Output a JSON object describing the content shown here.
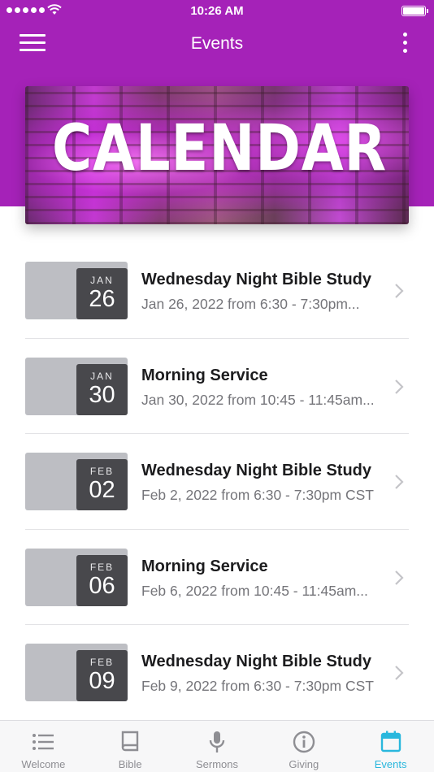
{
  "status_bar": {
    "time": "10:26 AM"
  },
  "nav": {
    "title": "Events"
  },
  "banner": {
    "text": "CALENDAR"
  },
  "events": [
    {
      "month": "JAN",
      "day": "26",
      "title": "Wednesday Night Bible Study",
      "time": "Jan 26, 2022 from 6:30 - 7:30pm..."
    },
    {
      "month": "JAN",
      "day": "30",
      "title": "Morning Service",
      "time": "Jan 30, 2022 from 10:45 - 11:45am..."
    },
    {
      "month": "FEB",
      "day": "02",
      "title": "Wednesday Night Bible Study",
      "time": "Feb 2, 2022 from 6:30 - 7:30pm CST"
    },
    {
      "month": "FEB",
      "day": "06",
      "title": "Morning Service",
      "time": "Feb 6, 2022 from 10:45 - 11:45am..."
    },
    {
      "month": "FEB",
      "day": "09",
      "title": "Wednesday Night Bible Study",
      "time": "Feb 9, 2022 from 6:30 - 7:30pm CST"
    }
  ],
  "tabs": [
    {
      "label": "Welcome",
      "icon": "list-icon"
    },
    {
      "label": "Bible",
      "icon": "book-icon"
    },
    {
      "label": "Sermons",
      "icon": "microphone-icon"
    },
    {
      "label": "Giving",
      "icon": "info-icon"
    },
    {
      "label": "Events",
      "icon": "calendar-icon",
      "active": true
    }
  ],
  "colors": {
    "header": "#a522b8",
    "active_tab": "#29b7dd",
    "date_badge": "#48484c"
  }
}
